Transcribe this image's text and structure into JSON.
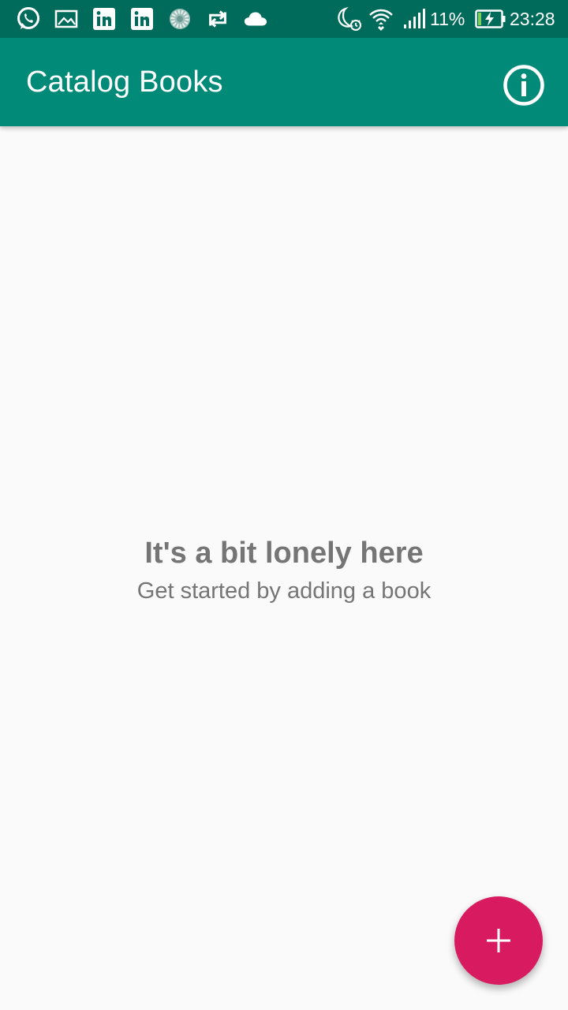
{
  "status_bar": {
    "notification_icons": [
      "whatsapp-icon",
      "image-icon",
      "linkedin-icon",
      "linkedin-icon",
      "sync-progress-icon",
      "repeat-icon",
      "cloud-icon"
    ],
    "system_icons": [
      "moon-alarm-icon",
      "wifi-icon",
      "signal-icon",
      "battery-charging-icon"
    ],
    "battery_percent": "11%",
    "time": "23:28"
  },
  "app_bar": {
    "title": "Catalog Books",
    "action_icon": "info-icon",
    "color": "#018a78"
  },
  "empty_state": {
    "title": "It's a bit lonely here",
    "subtitle": "Get started by adding a book"
  },
  "fab": {
    "icon": "plus-icon",
    "color": "#d81b60"
  },
  "colors": {
    "status_bar": "#016b5b",
    "background": "#fafafa",
    "text_secondary": "#757575"
  }
}
